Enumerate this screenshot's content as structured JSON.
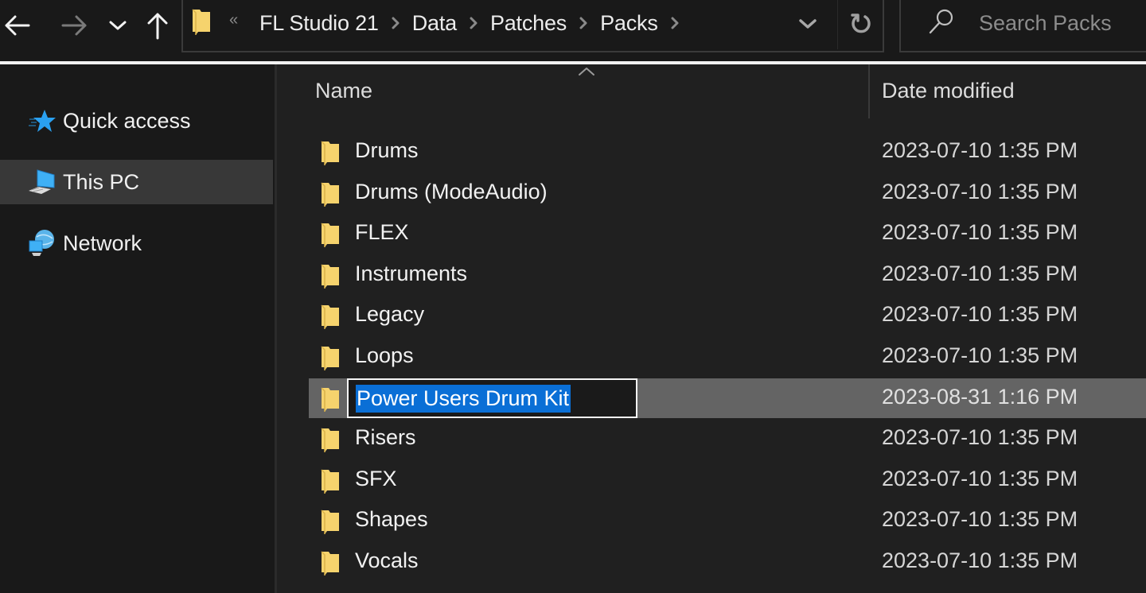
{
  "toolbar": {
    "back_icon": "back-arrow-icon",
    "forward_icon": "forward-arrow-icon",
    "recent_icon": "chevron-down-icon",
    "up_icon": "up-arrow-icon"
  },
  "address_bar": {
    "folder_icon": "folder-icon",
    "overflow_label": "«",
    "breadcrumbs": [
      {
        "label": "FL Studio 21"
      },
      {
        "label": "Data"
      },
      {
        "label": "Patches"
      },
      {
        "label": "Packs"
      }
    ],
    "dropdown_icon": "chevron-down-icon",
    "refresh_icon": "refresh-icon"
  },
  "search": {
    "placeholder": "Search Packs",
    "value": ""
  },
  "sidebar": {
    "items": [
      {
        "label": "Quick access",
        "icon": "star-icon",
        "selected": false
      },
      {
        "label": "This PC",
        "icon": "computer-icon",
        "selected": true
      },
      {
        "label": "Network",
        "icon": "network-icon",
        "selected": false
      }
    ]
  },
  "file_list": {
    "columns": [
      {
        "label": "Name",
        "sorted": "ascending"
      },
      {
        "label": "Date modified"
      }
    ],
    "rows": [
      {
        "name": "Drums",
        "date": "2023-07-10 1:35 PM"
      },
      {
        "name": "Drums (ModeAudio)",
        "date": "2023-07-10 1:35 PM"
      },
      {
        "name": "FLEX",
        "date": "2023-07-10 1:35 PM"
      },
      {
        "name": "Instruments",
        "date": "2023-07-10 1:35 PM"
      },
      {
        "name": "Legacy",
        "date": "2023-07-10 1:35 PM"
      },
      {
        "name": "Loops",
        "date": "2023-07-10 1:35 PM"
      },
      {
        "name": "Power Users Drum Kit",
        "date": "2023-08-31 1:16 PM",
        "selected": true,
        "renaming": true
      },
      {
        "name": "Risers",
        "date": "2023-07-10 1:35 PM"
      },
      {
        "name": "SFX",
        "date": "2023-07-10 1:35 PM"
      },
      {
        "name": "Shapes",
        "date": "2023-07-10 1:35 PM"
      },
      {
        "name": "Vocals",
        "date": "2023-07-10 1:35 PM"
      }
    ]
  },
  "colors": {
    "background": "#191919",
    "content_background": "#202020",
    "selected_row": "#646464",
    "selection_highlight": "#0a6fd6",
    "folder_yellow": "#f6d36d",
    "accent_blue": "#2aa0f0"
  }
}
